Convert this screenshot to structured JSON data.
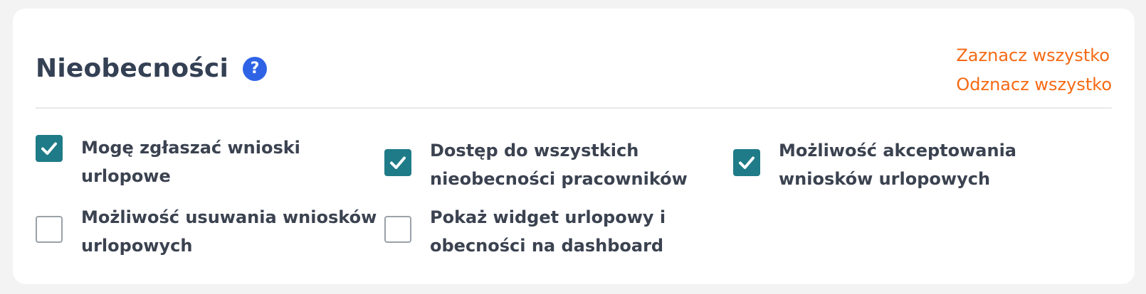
{
  "section": {
    "title": "Nieobecności",
    "help_icon": "question-circle-icon",
    "select_all": "Zaznacz wszystko",
    "deselect_all": "Odznacz wszystko"
  },
  "colors": {
    "accent_link": "#f56a14",
    "checkbox_checked": "#1f7b88",
    "help_icon": "#2f63e6",
    "title": "#344054"
  },
  "options": [
    {
      "label": "Mogę zgłaszać wnioski urlopowe",
      "checked": true
    },
    {
      "label": "Dostęp do wszystkich nieobecności pracowników",
      "checked": true
    },
    {
      "label": "Możliwość akceptowania wniosków urlopowych",
      "checked": true
    },
    {
      "label": "Możliwość usuwania wniosków urlopowych",
      "checked": false
    },
    {
      "label": "Pokaż widget urlopowy i obecności na dashboard",
      "checked": false
    }
  ]
}
